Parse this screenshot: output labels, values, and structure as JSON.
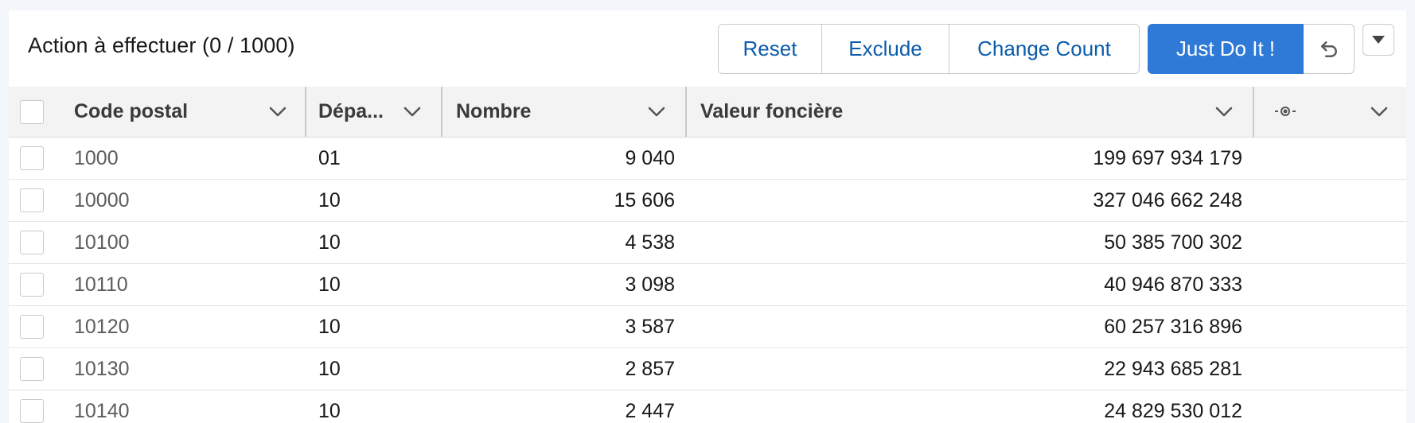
{
  "toolbar": {
    "title": "Action à effectuer (0 / 1000)",
    "reset_label": "Reset",
    "exclude_label": "Exclude",
    "change_count_label": "Change Count",
    "just_do_it_label": "Just Do It !",
    "undo_icon": "undo-icon",
    "menu_icon": "caret-down-icon"
  },
  "colors": {
    "accent": "#2e7ad6",
    "link": "#0b5cab",
    "header_bg": "#f3f3f3",
    "border": "#c9c9c9"
  },
  "table": {
    "columns": [
      {
        "label": "Code postal"
      },
      {
        "label": "Dépa..."
      },
      {
        "label": "Nombre"
      },
      {
        "label": "Valeur foncière"
      },
      {
        "label": "",
        "icon": "target-icon"
      }
    ],
    "rows": [
      {
        "code_postal": "1000",
        "departement": "01",
        "nombre": "9 040",
        "valeur": "199 697 934 179"
      },
      {
        "code_postal": "10000",
        "departement": "10",
        "nombre": "15 606",
        "valeur": "327 046 662 248"
      },
      {
        "code_postal": "10100",
        "departement": "10",
        "nombre": "4 538",
        "valeur": "50 385 700 302"
      },
      {
        "code_postal": "10110",
        "departement": "10",
        "nombre": "3 098",
        "valeur": "40 946 870 333"
      },
      {
        "code_postal": "10120",
        "departement": "10",
        "nombre": "3 587",
        "valeur": "60 257 316 896"
      },
      {
        "code_postal": "10130",
        "departement": "10",
        "nombre": "2 857",
        "valeur": "22 943 685 281"
      },
      {
        "code_postal": "10140",
        "departement": "10",
        "nombre": "2 447",
        "valeur": "24 829 530 012"
      }
    ]
  }
}
